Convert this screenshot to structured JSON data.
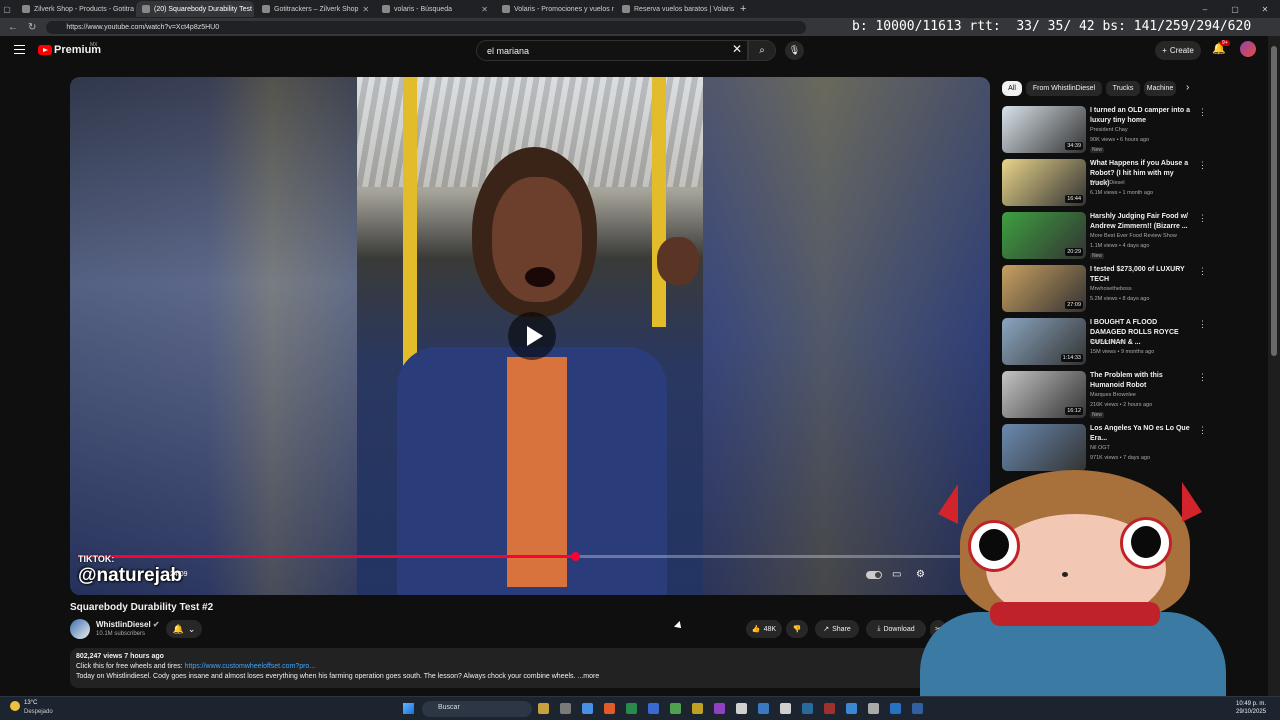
{
  "browser": {
    "tabs": [
      {
        "title": "Zilverk Shop - Products - Gotitracke",
        "active": false
      },
      {
        "title": "(20) Squarebody Durability Test #2",
        "active": true
      },
      {
        "title": "Gotitrackers – Zilverk Shop",
        "active": false
      },
      {
        "title": "volaris - Búsqueda",
        "active": false
      },
      {
        "title": "Volaris - Promociones y vuelos m",
        "active": false
      },
      {
        "title": "Reserva vuelos baratos | Volaris",
        "active": false
      }
    ],
    "new_tab": "+",
    "url": "https://www.youtube.com/watch?v=Xct4p8z5HU0",
    "stats_overlay": "b: 10000/11613 rtt:  33/ 35/ 42 bs: 141/259/294/620"
  },
  "header": {
    "logo": "Premium",
    "logo_region": "MX",
    "search_value": "el mariana",
    "create_label": "Create",
    "notifications_badge": "9+"
  },
  "player": {
    "watermark_top": "TIKTOK:",
    "watermark": "@naturejab",
    "timecode": "24:09",
    "progress_fraction": 0.55
  },
  "video": {
    "title": "Squarebody Durability Test #2",
    "channel": "WhistlinDiesel",
    "subscribers": "10.1M subscribers",
    "likes": "48K",
    "share_label": "Share",
    "download_label": "Download",
    "views_age": "802,247 views  7 hours ago",
    "desc_line1": "Click this for free wheels and tires: ",
    "desc_link": "https://www.customwheeloffset.com?pro...",
    "desc_line2": "Today on Whistlindiesel. Cody goes insane and almost loses everything when his farming operation goes south. The lesson? Always chock your combine wheels.  ...more"
  },
  "chips": [
    "All",
    "From WhistlinDiesel",
    "Trucks",
    "Machine"
  ],
  "recommendations": [
    {
      "title": "I turned an OLD camper into a luxury tiny home",
      "channel": "President Chay",
      "meta": "90K views • 6 hours ago",
      "badge": "New",
      "duration": "34:39",
      "thumb": "#d9e2ea"
    },
    {
      "title": "What Happens if you Abuse a Robot? (I hit him with my truck)",
      "channel": "WhistlinDiesel",
      "meta": "6.1M views • 1 month ago",
      "badge": "",
      "duration": "16:44",
      "thumb": "#e8d48a"
    },
    {
      "title": "Harshly Judging Fair Food w/ Andrew Zimmern!! (Bizarre ...",
      "channel": "More Best Ever Food Review Show",
      "meta": "1.1M views • 4 days ago",
      "badge": "New",
      "duration": "20:29",
      "thumb": "#3da040"
    },
    {
      "title": "I tested $273,000 of LUXURY TECH",
      "channel": "Mrwhosetheboss",
      "meta": "5.2M views • 8 days ago",
      "badge": "",
      "duration": "27:09",
      "thumb": "#c9a060"
    },
    {
      "title": "I BOUGHT A FLOOD DAMAGED ROLLS ROYCE CULLINAN & ...",
      "channel": "Mat Armstrong",
      "meta": "15M views • 9 months ago",
      "badge": "",
      "duration": "1:14:33",
      "thumb": "#8aa6c0"
    },
    {
      "title": "The Problem with this Humanoid Robot",
      "channel": "Marques Brownlee",
      "meta": "216K views • 2 hours ago",
      "badge": "New",
      "duration": "16:12",
      "thumb": "#c4c4c4"
    },
    {
      "title": "Los Angeles Ya NO es Lo Que Era...",
      "channel": "Nil OGT",
      "meta": "971K views • 7 days ago",
      "badge": "",
      "duration": "",
      "thumb": "#6a8ab0"
    }
  ],
  "taskbar": {
    "temp": "13°C",
    "weather": "Despejado",
    "search_placeholder": "Buscar",
    "time": "10:49 p. m.",
    "date": "29/10/2025"
  }
}
